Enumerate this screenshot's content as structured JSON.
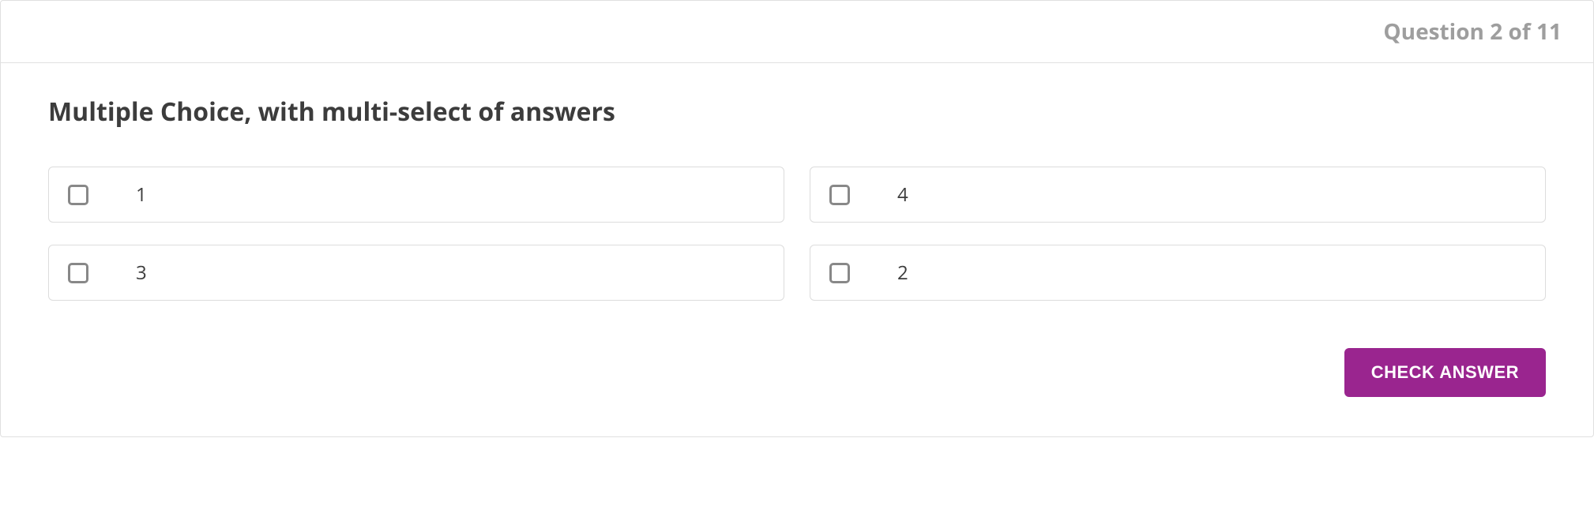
{
  "header": {
    "question_count": "Question 2 of 11"
  },
  "question": {
    "text": "Multiple Choice, with multi-select of answers"
  },
  "options": [
    {
      "label": "1"
    },
    {
      "label": "4"
    },
    {
      "label": "3"
    },
    {
      "label": "2"
    }
  ],
  "footer": {
    "check_label": "CHECK ANSWER"
  }
}
